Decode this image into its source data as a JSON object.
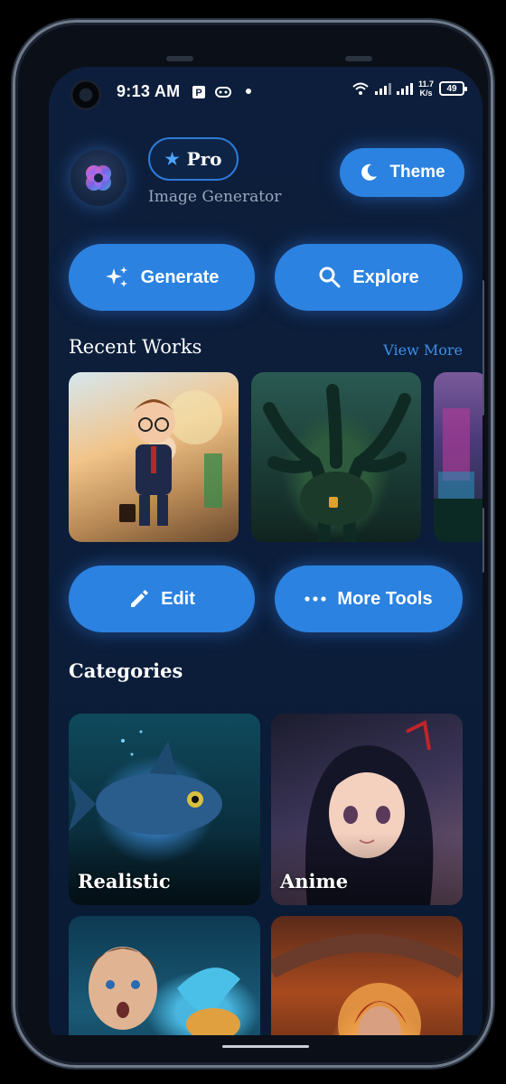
{
  "status_bar": {
    "time": "9:13 AM",
    "network_speed_value": "11.7",
    "network_speed_unit": "K/s",
    "battery": "49",
    "icons": [
      "camera-icon",
      "p-icon",
      "game-icon",
      "dot-icon",
      "wifi-icon",
      "signal-icon",
      "battery-icon"
    ]
  },
  "header": {
    "badge_label": "Pro",
    "subtitle": "Image Generator",
    "theme_label": "Theme"
  },
  "actions": {
    "generate_label": "Generate",
    "explore_label": "Explore",
    "edit_label": "Edit",
    "more_tools_label": "More Tools"
  },
  "recent": {
    "title": "Recent Works",
    "view_more": "View More"
  },
  "categories": {
    "title": "Categories",
    "items": [
      {
        "label": "Realistic"
      },
      {
        "label": "Anime"
      },
      {
        "label": ""
      },
      {
        "label": ""
      }
    ]
  },
  "colors": {
    "accent": "#2b82e0",
    "background": "#0c1e3b",
    "link": "#3f8fe6"
  }
}
